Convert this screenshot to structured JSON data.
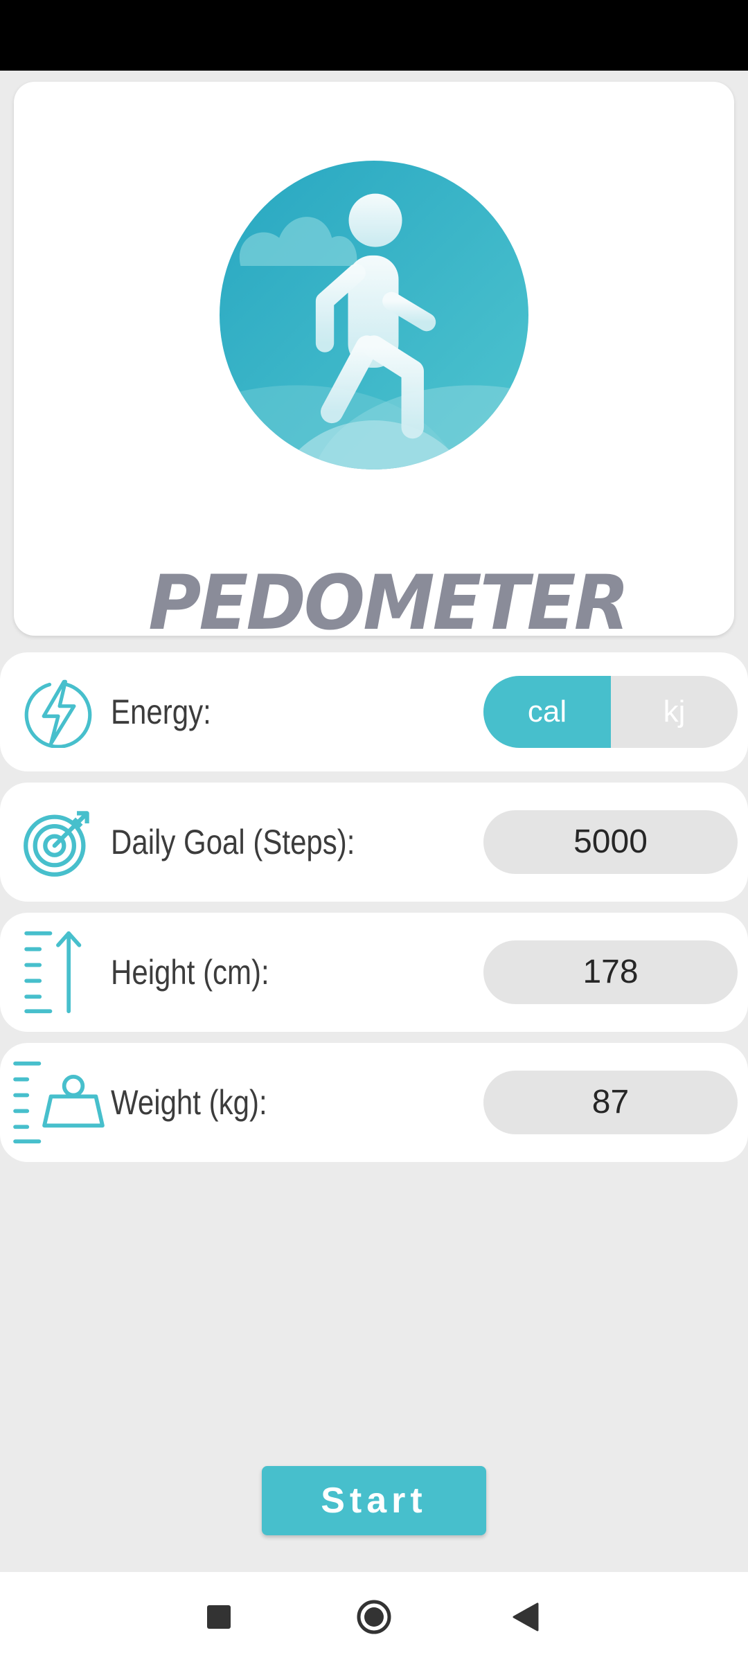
{
  "app": {
    "title": "PEDOMETER"
  },
  "settings": {
    "energy": {
      "label": "Energy:",
      "icon": "lightning-bolt-icon",
      "options": [
        "cal",
        "kj"
      ],
      "selected": "cal"
    },
    "goal": {
      "label": "Daily Goal (Steps):",
      "icon": "target-arrow-icon",
      "value": "5000"
    },
    "height": {
      "label": "Height (cm):",
      "icon": "height-ruler-icon",
      "value": "178"
    },
    "weight": {
      "label": "Weight (kg):",
      "icon": "weight-scale-icon",
      "value": "87"
    }
  },
  "start_label": "Start",
  "nav": {
    "recents": "square-icon",
    "home": "circle-icon",
    "back": "triangle-back-icon"
  },
  "colors": {
    "accent": "#47bfcc",
    "title": "#8a8c99",
    "background": "#ebebeb"
  }
}
